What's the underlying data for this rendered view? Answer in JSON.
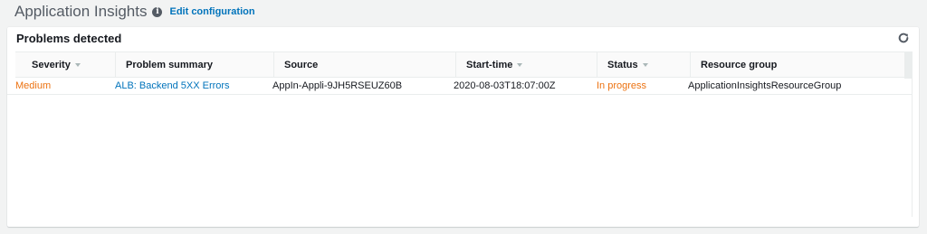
{
  "header": {
    "title": "Application Insights",
    "edit_label": "Edit configuration"
  },
  "panel": {
    "title": "Problems detected"
  },
  "table": {
    "columns": [
      {
        "label": "Severity",
        "sortable": true
      },
      {
        "label": "Problem summary",
        "sortable": false
      },
      {
        "label": "Source",
        "sortable": false
      },
      {
        "label": "Start-time",
        "sortable": true
      },
      {
        "label": "Status",
        "sortable": true
      },
      {
        "label": "Resource group",
        "sortable": false
      }
    ],
    "rows": [
      {
        "severity": "Medium",
        "summary": "ALB: Backend 5XX Errors",
        "source": "AppIn-Appli-9JH5RSEUZ60B",
        "start_time": "2020-08-03T18:07:00Z",
        "status": "In progress",
        "resource_group": "ApplicationInsightsResourceGroup"
      }
    ]
  },
  "colors": {
    "severity_medium": "#ec7211",
    "link": "#0073bb",
    "status_in_progress": "#ec7211"
  },
  "icons": {
    "info": "info-icon",
    "refresh": "refresh-icon",
    "sort": "caret-down-icon"
  }
}
